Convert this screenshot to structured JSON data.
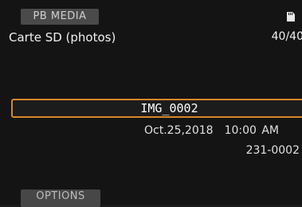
{
  "header": {
    "mode_label": "PB MEDIA",
    "title": "Carte SD (photos)",
    "count": "40/40",
    "media_icon": "sd-card-icon"
  },
  "selected_item": {
    "filename": "IMG_0002",
    "date": "Oct.25,2018",
    "time": "10:00 AM",
    "folder_number": "231-0002"
  },
  "footer": {
    "options_label": "OPTIONS"
  },
  "colors": {
    "selection_border": "#d9862b",
    "background": "#141414",
    "tab_background": "#4a4a4a"
  }
}
